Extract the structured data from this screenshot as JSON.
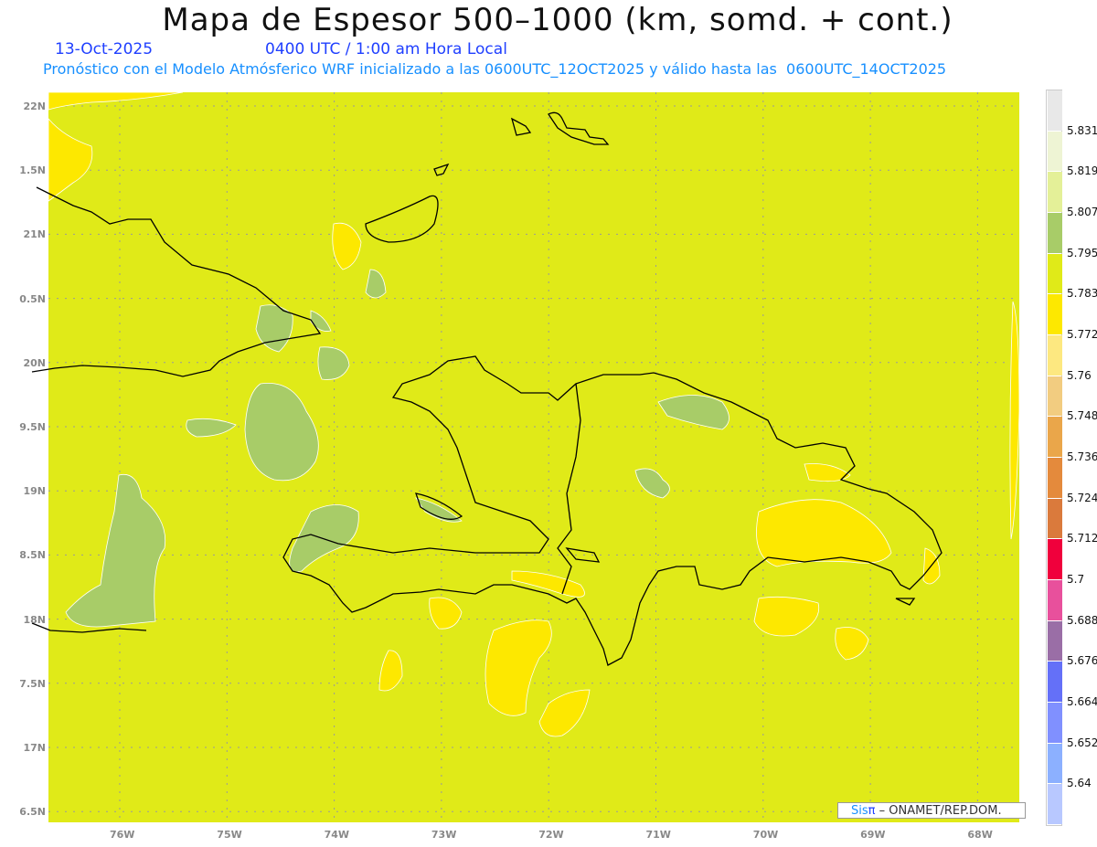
{
  "header": {
    "title": "Mapa de Espesor 500–1000 (km, somd. + cont.)",
    "date": "13-Oct-2025",
    "time": "0400 UTC / 1:00 am Hora Local",
    "description": "Pronóstico con el Modelo Atmósferico WRF inicializado a las 0600UTC_12OCT2025 y válido hasta las  0600UTC_14OCT2025"
  },
  "map": {
    "lat_labels": [
      "22N",
      "1.5N",
      "21N",
      "0.5N",
      "20N",
      "9.5N",
      "19N",
      "8.5N",
      "18N",
      "7.5N",
      "17N",
      "6.5N"
    ],
    "lon_labels": [
      "76W",
      "75W",
      "74W",
      "73W",
      "72W",
      "71W",
      "70W",
      "69W",
      "68W"
    ],
    "background_color": "#e0ea18",
    "credit": {
      "sis": "Sis",
      "pi": "π",
      "text": " –  ONAMET/REP.DOM."
    }
  },
  "colorbar": {
    "colors": [
      "#e8e8e8",
      "#eef4d4",
      "#e4f098",
      "#a8cc68",
      "#e0ea18",
      "#fde800",
      "#fde880",
      "#f2cc80",
      "#eaa64a",
      "#e48a3c",
      "#da7a3c",
      "#f0003c",
      "#e8509c",
      "#9a6ea6",
      "#6470f8",
      "#8090ff",
      "#8cb0ff",
      "#b8c8ff"
    ],
    "labels": [
      "5.831",
      "5.819",
      "5.807",
      "5.795",
      "5.783",
      "5.772",
      "5.76",
      "5.748",
      "5.736",
      "5.724",
      "5.712",
      "5.7",
      "5.688",
      "5.676",
      "5.664",
      "5.652",
      "5.64"
    ]
  }
}
